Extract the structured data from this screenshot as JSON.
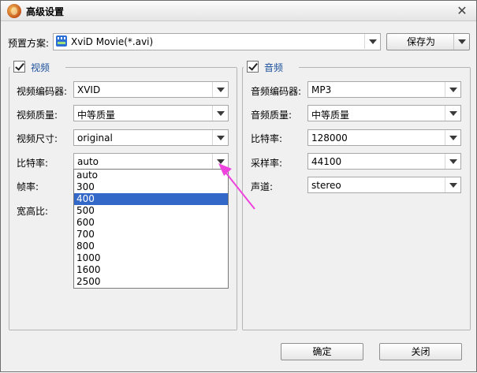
{
  "window": {
    "title": "高级设置",
    "icon": "app-logo-icon",
    "close_icon": "close-icon"
  },
  "preset": {
    "label": "预置方案:",
    "value": "XviD Movie(*.avi)",
    "icon": "video-film-icon",
    "save_as_label": "保存为"
  },
  "video": {
    "enabled": true,
    "title": "视频",
    "codec_label": "视频编码器:",
    "codec_value": "XVID",
    "quality_label": "视频质量:",
    "quality_value": "中等质量",
    "size_label": "视频尺寸:",
    "size_value": "original",
    "bitrate_label": "比特率:",
    "bitrate_value": "auto",
    "framerate_label": "帧率:",
    "aspect_label": "宽高比:",
    "bitrate_options": [
      "auto",
      "300",
      "400",
      "500",
      "600",
      "700",
      "800",
      "1000",
      "1600",
      "2500"
    ],
    "bitrate_highlighted": "400"
  },
  "audio": {
    "enabled": true,
    "title": "音频",
    "codec_label": "音频编码器:",
    "codec_value": "MP3",
    "quality_label": "音频质量:",
    "quality_value": "中等质量",
    "bitrate_label": "比特率:",
    "bitrate_value": "128000",
    "samplerate_label": "采样率:",
    "samplerate_value": "44100",
    "channel_label": "声道:",
    "channel_value": "stereo"
  },
  "footer": {
    "ok_label": "确定",
    "close_label": "关闭"
  },
  "colors": {
    "accent": "#3468c8",
    "group_title": "#1b4f9c",
    "annotation_arrow": "#ee44dd"
  }
}
